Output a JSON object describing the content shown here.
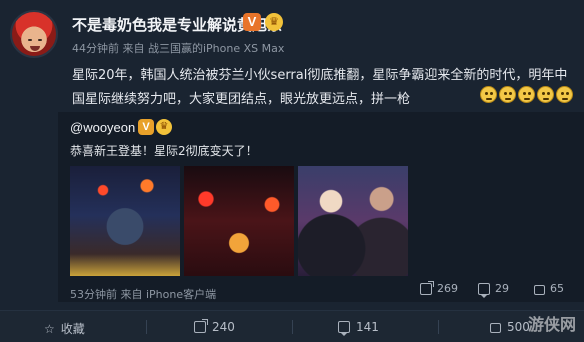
{
  "post": {
    "username": "不是毒奶色我是专业解说黄旭东",
    "verified_badge": "V",
    "meta": "44分钟前 来自 战三国赢的iPhone XS Max",
    "text": "星际20年，韩国人统治被芬兰小伙serral彻底推翻，星际争霸迎来全新的时代，明年中国星际继续努力吧，大家更团结点，眼光放更远点，拼一枪"
  },
  "repost": {
    "username": "@wooyeon",
    "verified_badge": "V",
    "text": "恭喜新王登基！星际2彻底变天了！",
    "meta": "53分钟前 来自 iPhone客户端",
    "share_count": "269",
    "comment_count": "29",
    "like_count": "65"
  },
  "footer": {
    "favorite_label": "收藏",
    "share_count": "240",
    "comment_count": "141",
    "like_count": "500"
  },
  "watermark": "游侠网",
  "colors": {
    "background": "#16202c",
    "card": "#1a2431",
    "repost_card": "#141c27",
    "verified_orange": "#e8742a"
  }
}
